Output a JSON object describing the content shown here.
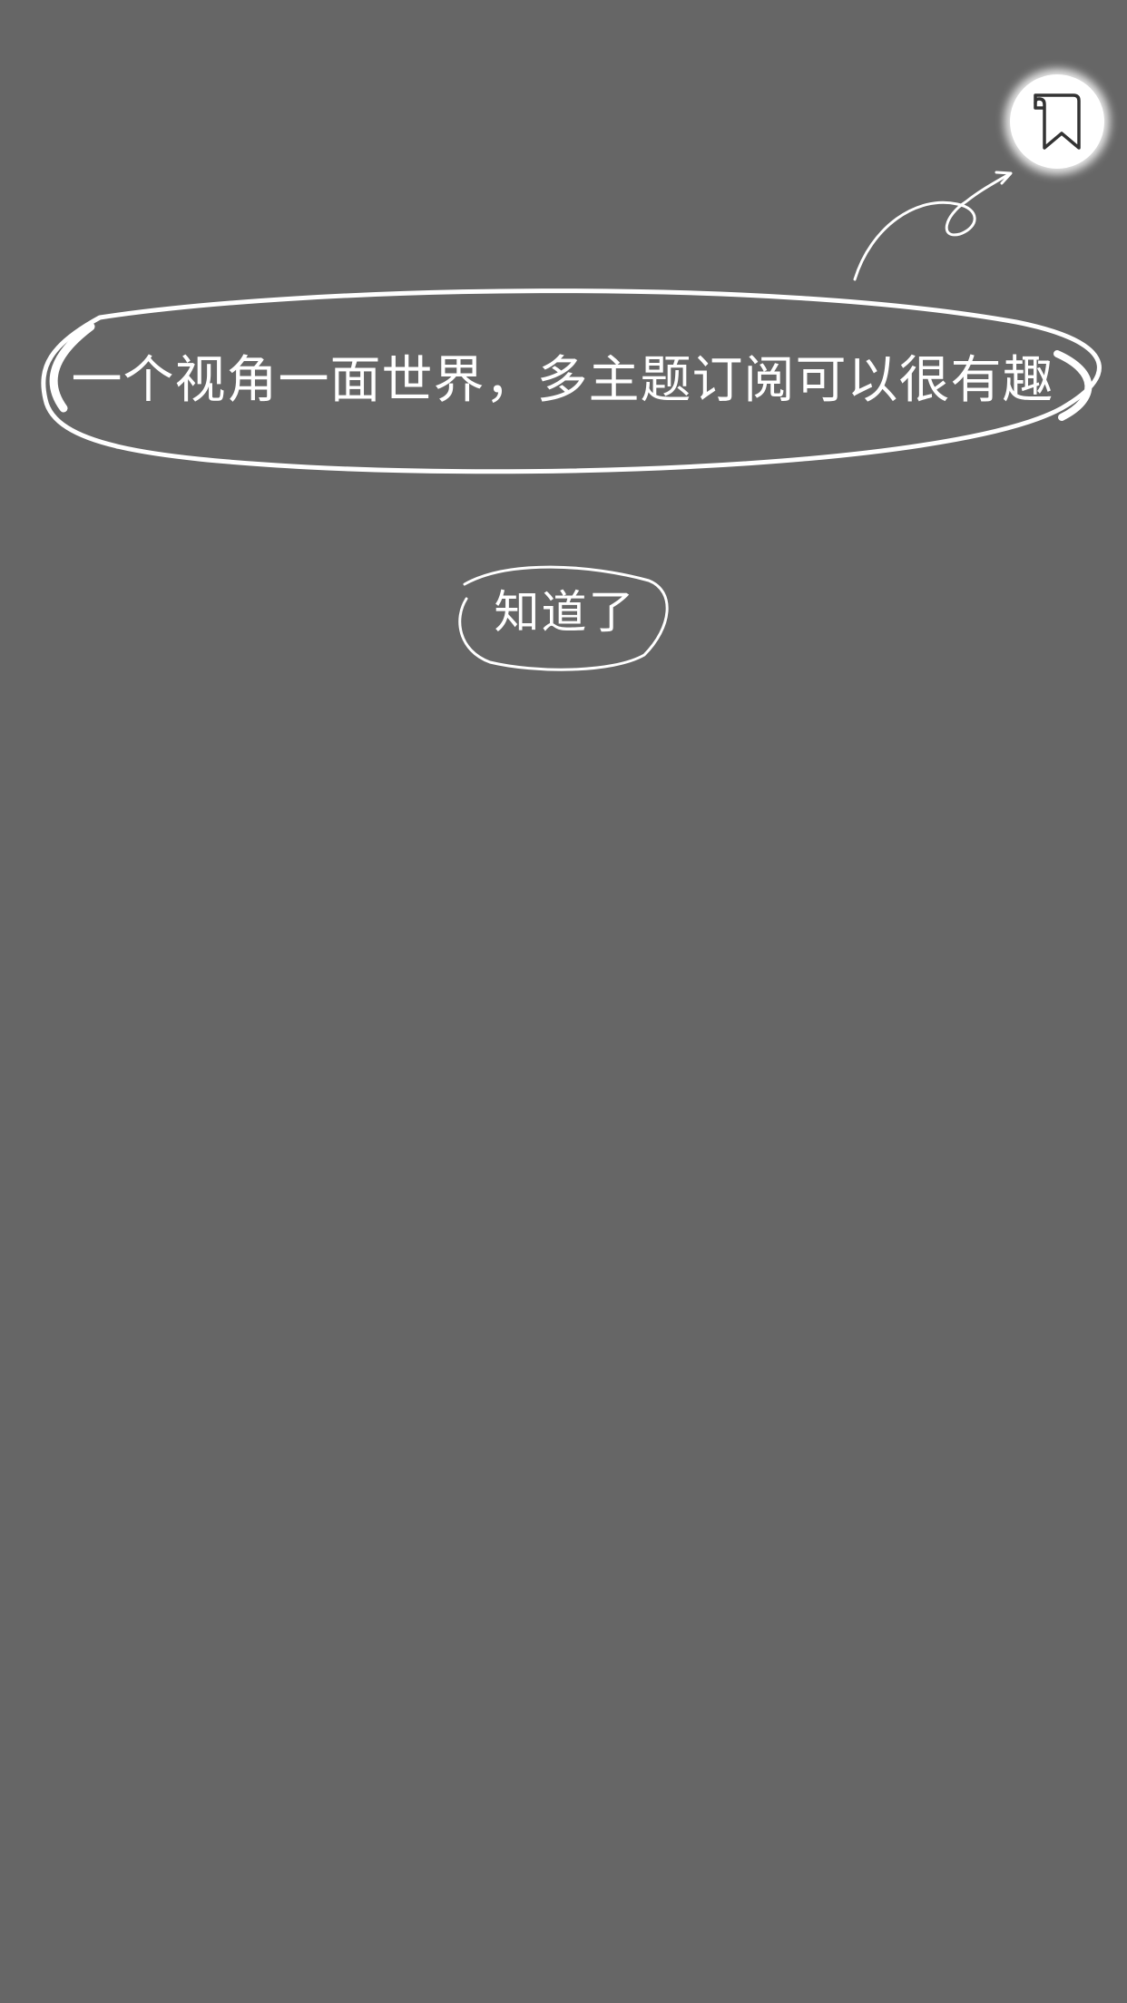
{
  "guide": {
    "tip_text": "一个视角一面世界，多主题订阅可以很有趣",
    "confirm_label": "知道了",
    "icon": "bookmark-icon",
    "colors": {
      "overlay": "#666666",
      "ink": "#ffffff",
      "icon_stroke": "#333333"
    }
  }
}
